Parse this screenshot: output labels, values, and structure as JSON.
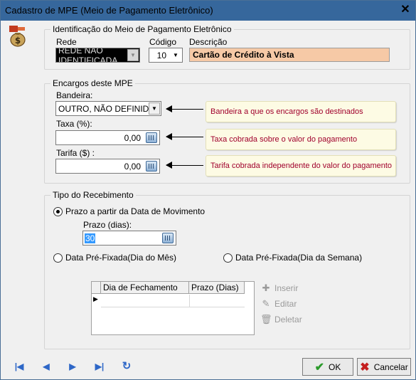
{
  "window": {
    "title": "Cadastro de MPE (Meio de Pagamento Eletrônico)",
    "close": "✕"
  },
  "ident": {
    "group_label": "Identificação do Meio de Pagamento Eletrônico",
    "rede_label": "Rede",
    "rede_value": "REDE NÃO IDENTIFICADA",
    "codigo_label": "Código",
    "codigo_value": "10",
    "descricao_label": "Descrição",
    "descricao_value": "Cartão de Crédito à Vista"
  },
  "encargos": {
    "group_label": "Encargos deste MPE",
    "bandeira_label": "Bandeira:",
    "bandeira_value": "OUTRO, NÃO DEFINIDO",
    "taxa_label": "Taxa (%):",
    "taxa_value": "0,00",
    "tarifa_label": "Tarifa ($) :",
    "tarifa_value": "0,00",
    "notes": {
      "bandeira": "Bandeira a que  os encargos são destinados",
      "taxa": "Taxa cobrada sobre o valor do pagamento",
      "tarifa": "Tarifa cobrada independente do valor do pagamento"
    }
  },
  "recebimento": {
    "group_label": "Tipo do Recebimento",
    "option_prazo": "Prazo a partir da Data de Movimento",
    "prazo_label": "Prazo (dias):",
    "prazo_value": "30",
    "option_mes": "Data Pré-Fixada(Dia do Mês)",
    "option_semana": "Data Pré-Fixada(Dia da Semana)",
    "selected": "prazo",
    "grid_columns": [
      "Dia de Fechamento",
      "Prazo (Dias)"
    ],
    "row_indicator": "▶",
    "inserir": "Inserir",
    "editar": "Editar",
    "deletar": "Deletar"
  },
  "footer": {
    "ok": "OK",
    "cancelar": "Cancelar"
  },
  "colors": {
    "title_bar": "#36679c",
    "descricao_bg": "#f6c9a6",
    "note_text": "#a0002c",
    "note_bg": "#fdfbe4"
  }
}
